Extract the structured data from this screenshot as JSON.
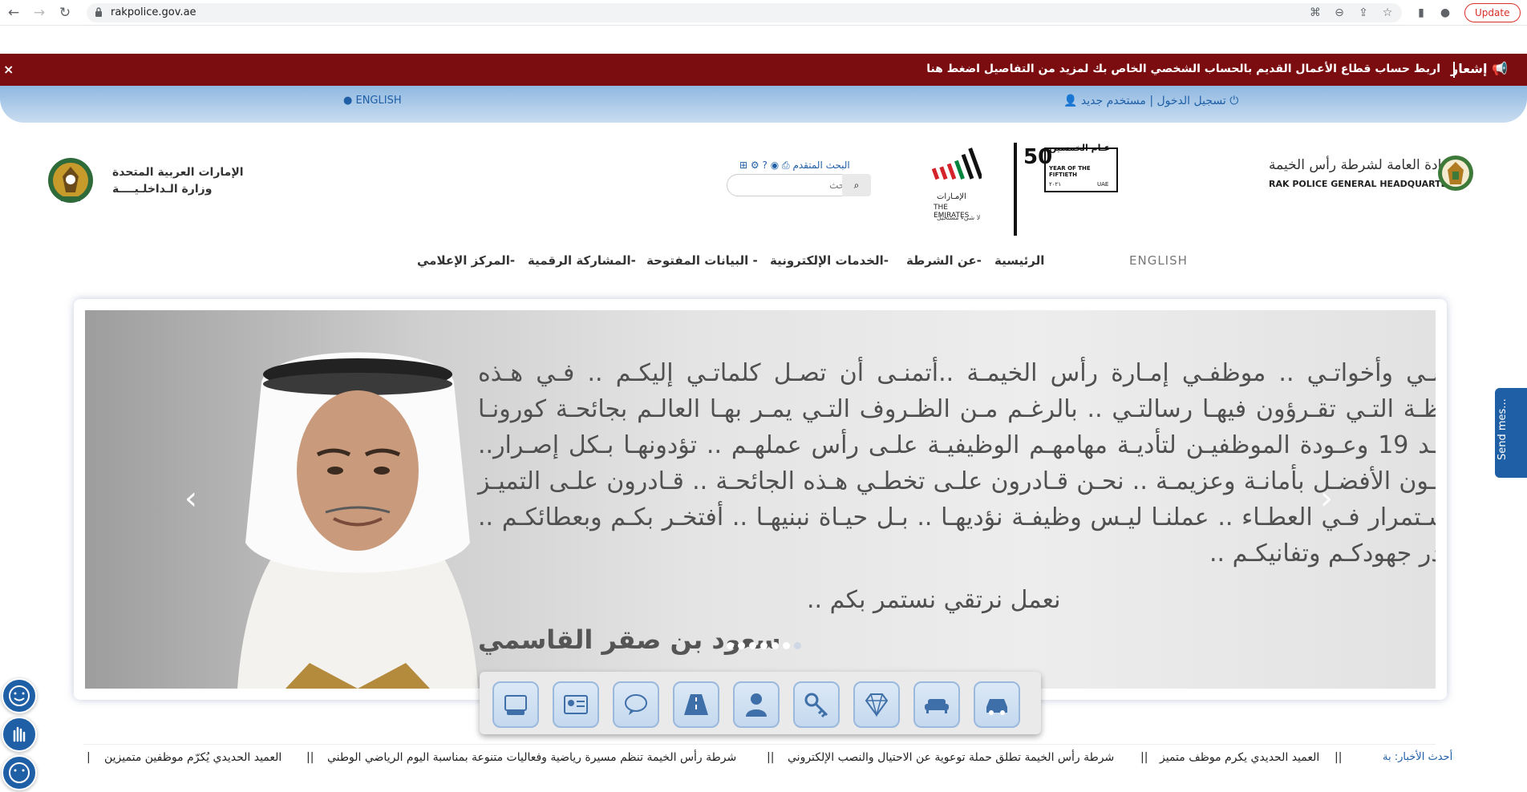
{
  "browser": {
    "url": "rakpolice.gov.ae",
    "update_label": "Update"
  },
  "notice": {
    "label": "إشعار",
    "text": "اربط حساب قطاع الأعمال القديم بالحساب الشخصي الخاص بك لمزيد من التفاصيل اضغط هنا",
    "close": "×"
  },
  "topbar": {
    "language": "ENGLISH",
    "login": "تسجيل الدخول",
    "separator": "|",
    "register": "مستخدم جديد"
  },
  "header": {
    "moi_line1": "الإمارات العربية المتحدة",
    "moi_line2": "وزارة الـداخلـيــــة",
    "rak_ar": "القيادة العامة لشرطة رأس الخيمة",
    "rak_en": "RAK POLICE GENERAL HEADQUARTERS",
    "fifty_ar": "عـام الخمسين",
    "fifty_en": "YEAR OF THE FIFTIETH",
    "fifty_digits": "50",
    "fifty_small_left": "٢٠٢١",
    "fifty_small_right": "UAE",
    "emirates_ar": "الإمـارات",
    "emirates_en": "THE EMIRATES",
    "emirates_tag": "لا شيء مستحيل"
  },
  "search": {
    "advanced": "البحث المتقدم",
    "placeholder": "بحث"
  },
  "nav": {
    "english": "ENGLISH",
    "home": "الرئيسية",
    "about": "عن الشرطة",
    "eservices": "الخدمات الإلكترونية",
    "opendata": "البيانات المفتوحة",
    "participation": "المشاركة الرقمية",
    "media": "المركز الإعلامي"
  },
  "slider": {
    "message": "إخوانـي وأخواتـي .. موظفـي إمـارة رأس الخيمـة ..أتمنـى أن تصـل كلماتـي إليكـم .. فـي هـذه اللحظـة التـي تقـرؤون فيهـا رسالتـي .. بالرغـم مـن الظـروف التـي يمـر بهـا العالـم بجائحـة كورونـا كوفيـد 19 وعـودة الموظفيـن لتأديـة مهامهـم الوظيفيـة علـى رأس عملهـم .. تؤدونهـا بـكل إصـرار.. تقدمـون الأفضـل بأمانـة وعزيمـة .. نحـن قـادرون علـى تخطـي هـذه الجائحـة .. قـادرون علـى التميـز والاسـتمرار فـي العطـاء .. عملنـا ليـس وظيفـة نؤديهـا .. بـل حيـاة نبنيهـا .. أفتخـر بكـم وبعطائكـم .. وأقـدر جهودكـم وتفانيكـم ..",
    "closing": "نعمل نرتقي نستمر بكم ..",
    "signature": "سعود بن صقر القاسمي",
    "prev": "‹",
    "next": "›",
    "dot_count": 7
  },
  "services": [
    "vehicle-license-icon",
    "id-card-icon",
    "chat-icon",
    "road-icon",
    "person-icon",
    "key-icon",
    "diamond-icon",
    "sofa-icon",
    "car-icon"
  ],
  "ticker": {
    "label": "أحدث الأخبار",
    "label_tail": "بة",
    "items": [
      "العميد الحديدي يكرم موظف متميز",
      "شرطة رأس الخيمة تطلق حملة توعوية عن الاحتيال والنصب الإلكتروني",
      "شرطة رأس الخيمة تنظم مسيرة رياضية وفعاليات متنوعة بمناسبة اليوم الرياضي الوطني",
      "العميد الحديدي يُكرّم موظفين متميزين"
    ],
    "separator": "||"
  },
  "feedback": {
    "label": "Send mes..."
  },
  "colors": {
    "notice_bg": "#7b0c10",
    "link": "#1f5fa6"
  }
}
